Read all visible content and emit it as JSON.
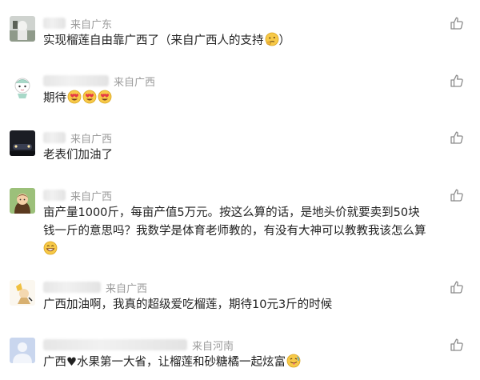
{
  "comments": [
    {
      "region": "来自广东",
      "text": "实现榴莲自由靠广西了（来自广西人的支持",
      "text_tail": "）",
      "emojis": [
        "thinking-face"
      ]
    },
    {
      "region": "来自广西",
      "text": "期待",
      "emojis": [
        "heart-eyes",
        "heart-eyes",
        "heart-eyes"
      ]
    },
    {
      "region": "来自广西",
      "text": "老表们加油了",
      "emojis": []
    },
    {
      "region": "来自广西",
      "text_line1": "亩产量1000斤，每亩产值5万元。按这么算的话，是地头价就要卖到50块",
      "text_line2": "钱一斤的意思吗？我数学是体育老师教的，有没有大神可以教教我该怎么算",
      "emojis": [
        "grinning-face"
      ]
    },
    {
      "region": "来自广西",
      "text": "广西加油啊，我真的超级爱吃榴莲，期待10元3斤的时候",
      "emojis": []
    },
    {
      "region": "来自河南",
      "text_before": "广西",
      "text_heart": "♥",
      "text_after": "水果第一大省，让榴莲和砂糖橘一起炫富",
      "emojis": [
        "face-with-tongue"
      ]
    }
  ],
  "colors": {
    "region_gray": "#9b9b9b",
    "like_icon": "#8a8a8a"
  }
}
